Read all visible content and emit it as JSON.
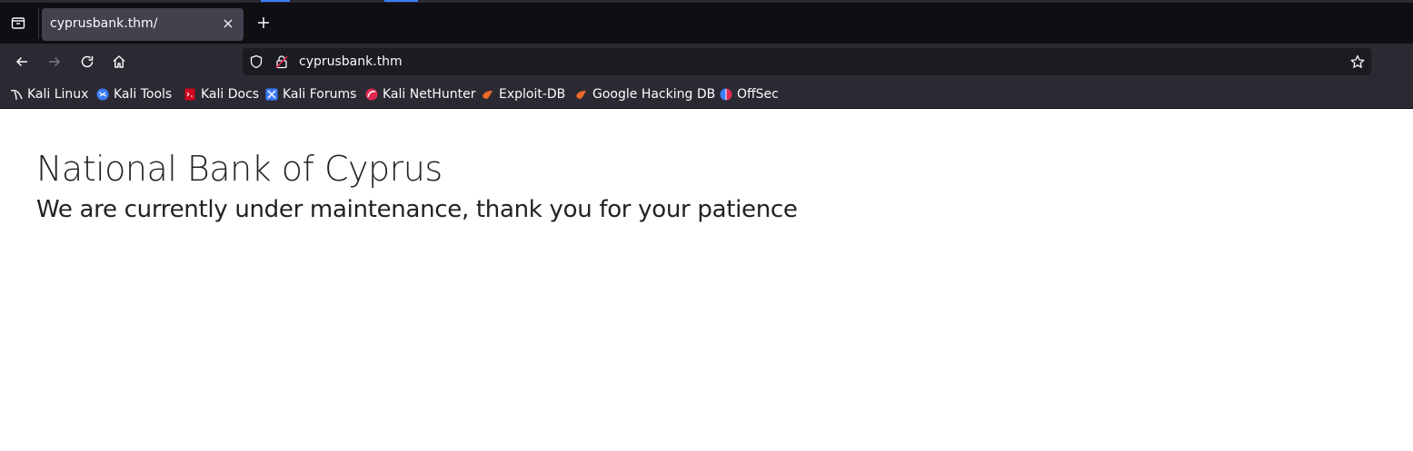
{
  "browser": {
    "tab": {
      "title": "cyprusbank.thm/"
    },
    "url": "cyprusbank.thm",
    "bookmarks": [
      {
        "label": "Kali Linux",
        "icon": "kali-dragon-icon"
      },
      {
        "label": "Kali Tools",
        "icon": "kali-tools-icon"
      },
      {
        "label": "Kali Docs",
        "icon": "kali-docs-icon"
      },
      {
        "label": "Kali Forums",
        "icon": "kali-forums-icon"
      },
      {
        "label": "Kali NetHunter",
        "icon": "kali-nethunter-icon"
      },
      {
        "label": "Exploit-DB",
        "icon": "exploit-db-icon"
      },
      {
        "label": "Google Hacking DB",
        "icon": "google-hacking-db-icon"
      },
      {
        "label": "OffSec",
        "icon": "offsec-icon"
      }
    ]
  },
  "page": {
    "heading": "National Bank of Cyprus",
    "message": "We are currently under maintenance, thank you for your patience"
  },
  "colors": {
    "chrome_dark": "#0f0e13",
    "toolbar": "#2b2a33",
    "urlbar": "#1c1b22",
    "tab_active": "#42414d",
    "accent": "#3a7cff"
  }
}
